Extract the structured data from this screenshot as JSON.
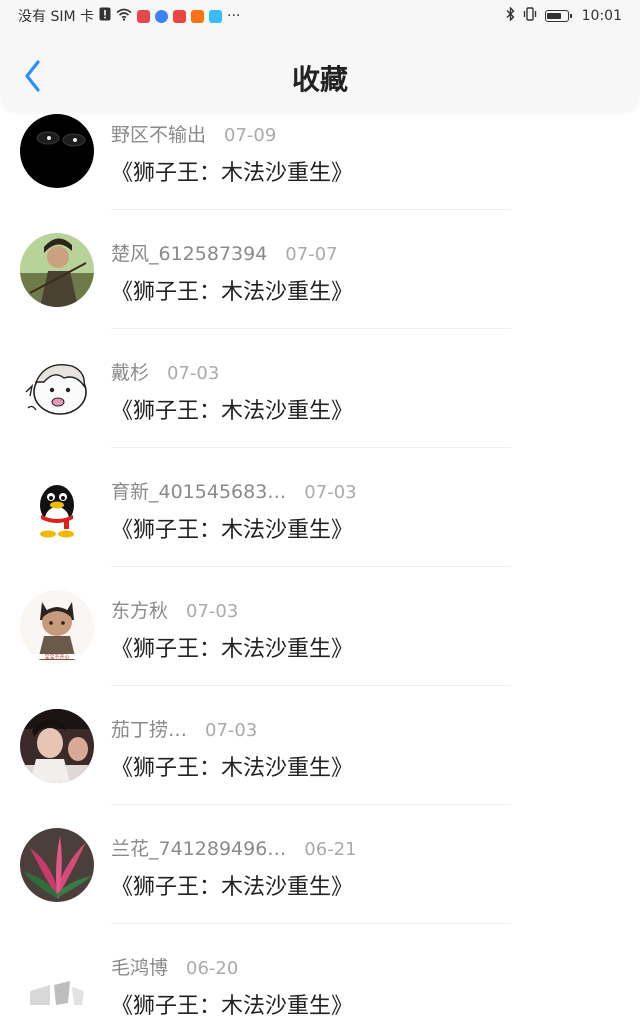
{
  "status_bar": {
    "carrier": "没有 SIM 卡",
    "time": "10:01",
    "app_icon_colors": [
      "#e5484d",
      "#3b82f6",
      "#ef4444",
      "#f97316",
      "#38bdf8"
    ],
    "more": "···",
    "battery_level": 0.8
  },
  "header": {
    "title": "收藏",
    "accent": "#2a8ff7"
  },
  "favorites": [
    {
      "author": "野区不输出",
      "date": "07-09",
      "title": "《狮子王：木法沙重生》"
    },
    {
      "author": "楚风_612587394",
      "date": "07-07",
      "title": "《狮子王：木法沙重生》"
    },
    {
      "author": "戴杉",
      "date": "07-03",
      "title": "《狮子王：木法沙重生》"
    },
    {
      "author": "育新_401545683…",
      "date": "07-03",
      "title": "《狮子王：木法沙重生》"
    },
    {
      "author": "东方秋",
      "date": "07-03",
      "title": "《狮子王：木法沙重生》"
    },
    {
      "author": "茄丁捞…",
      "date": "07-03",
      "title": "《狮子王：木法沙重生》"
    },
    {
      "author": "兰花_741289496…",
      "date": "06-21",
      "title": "《狮子王：木法沙重生》"
    },
    {
      "author": "毛鸿博",
      "date": "06-20",
      "title": "《狮子王：木法沙重生》"
    }
  ]
}
